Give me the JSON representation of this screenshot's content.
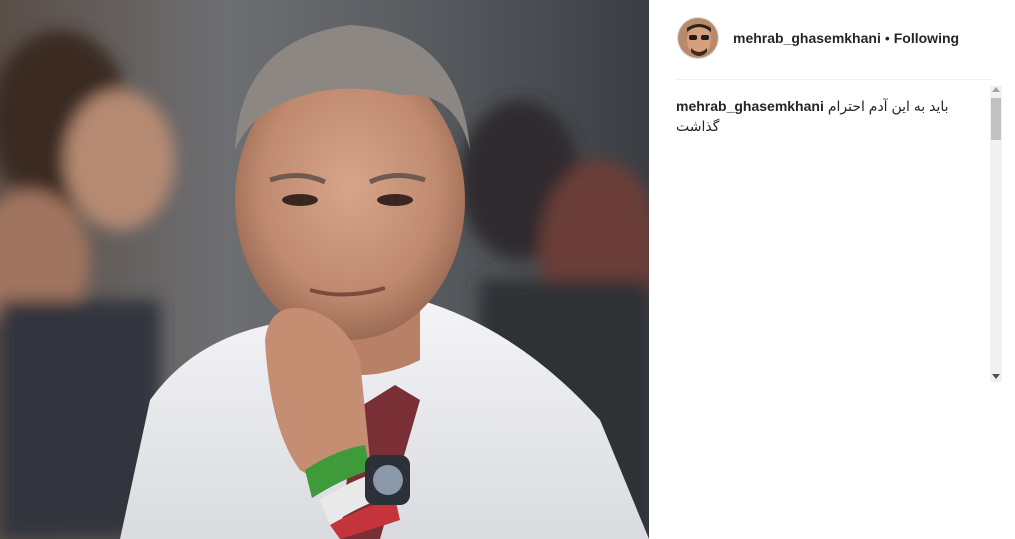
{
  "post": {
    "image_alt": "Photo of a grey-haired man in a white shirt, hand on chin"
  },
  "header": {
    "username": "mehrab_ghasemkhani",
    "separator": "•",
    "follow_status": "Following"
  },
  "comments": [
    {
      "username": "mehrab_ghasemkhani",
      "text": "باید به این آدم احترام گذاشت"
    }
  ],
  "colors": {
    "text": "#262626",
    "divider": "#efefef"
  }
}
